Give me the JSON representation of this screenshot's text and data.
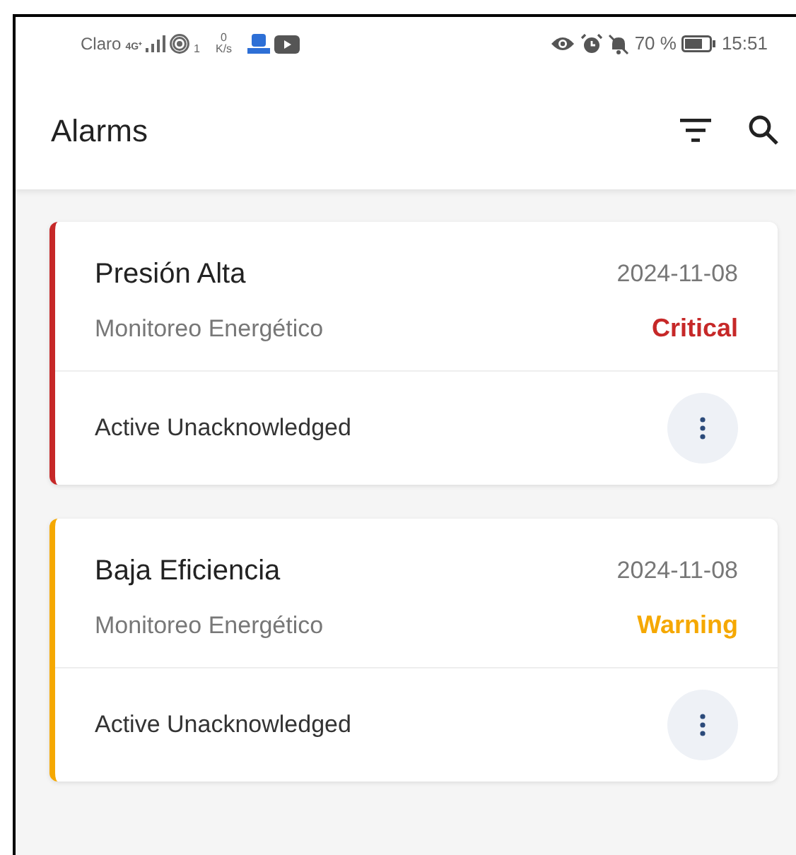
{
  "status_bar": {
    "carrier": "Claro",
    "network": "4G⁺",
    "hotspot_count": "1",
    "speed_value": "0",
    "speed_unit": "K/s",
    "battery": "70 %",
    "time": "15:51"
  },
  "app_bar": {
    "title": "Alarms"
  },
  "alarms": [
    {
      "name": "Presión Alta",
      "date": "2024-11-08",
      "source": "Monitoreo Energético",
      "severity": "Critical",
      "color": "#c62828",
      "state": "Active Unacknowledged"
    },
    {
      "name": "Baja Eficiencia",
      "date": "2024-11-08",
      "source": "Monitoreo Energético",
      "severity": "Warning",
      "color": "#f5a800",
      "state": "Active Unacknowledged"
    }
  ]
}
